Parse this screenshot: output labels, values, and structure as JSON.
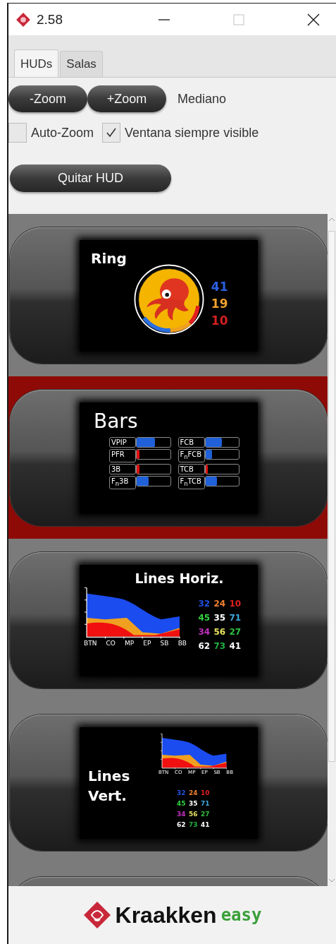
{
  "window": {
    "title": "2.58"
  },
  "tabs": [
    {
      "label": "HUDs",
      "selected": true
    },
    {
      "label": "Salas",
      "selected": false
    }
  ],
  "zoom": {
    "buttons": [
      "-Zoom",
      "+Zoom"
    ],
    "size": "Mediano"
  },
  "options": [
    {
      "label": "Auto-Zoom",
      "checked": false
    },
    {
      "label": "Ventana siempre visible",
      "checked": true
    }
  ],
  "remove_button": "Quitar HUD",
  "huds": [
    {
      "kind": "ring",
      "title": "Ring",
      "selected": false,
      "stats": [
        {
          "value": "41",
          "color": "#2a5fe0"
        },
        {
          "value": "19",
          "color": "#f0a030"
        },
        {
          "value": "10",
          "color": "#d42020"
        }
      ]
    },
    {
      "kind": "bars",
      "title": "Bars",
      "selected": true,
      "bars": [
        {
          "label": "VPIP",
          "level": 0.55,
          "color": "#2060d8"
        },
        {
          "label": "FCB",
          "level": 0.5,
          "color": "#2060d8"
        },
        {
          "label": "PFR",
          "level": 0.08,
          "color": "#e01010"
        },
        {
          "label": "F$_{n}$FCB",
          "level": 0.2,
          "color": "#2060d8"
        },
        {
          "label": "3B",
          "level": 0.08,
          "color": "#e01010"
        },
        {
          "label": "TCB",
          "level": 0.08,
          "color": "#e01010"
        },
        {
          "label": "F$_{n}$3B",
          "level": 0.35,
          "color": "#2060d8"
        },
        {
          "label": "F$_{n}$TCB",
          "level": 0.35,
          "color": "#2060d8"
        }
      ]
    },
    {
      "kind": "lines_horizontal",
      "title": "Lines Horiz.",
      "selected": false,
      "positions": [
        "BTN",
        "CO",
        "MP",
        "EP",
        "SB",
        "BB"
      ],
      "stats": [
        {
          "value": "32",
          "color": "#2050e0"
        },
        {
          "value": "24",
          "color": "#f08030"
        },
        {
          "value": "10",
          "color": "#e02020"
        },
        {
          "value": "45",
          "color": "#30d040"
        },
        {
          "value": "35",
          "color": "#ffffff"
        },
        {
          "value": "71",
          "color": "#40a8e0"
        },
        {
          "value": "34",
          "color": "#c030c0"
        },
        {
          "value": "56",
          "color": "#e8e060"
        },
        {
          "value": "27",
          "color": "#30c040"
        },
        {
          "value": "62",
          "color": "#ffffff"
        },
        {
          "value": "73",
          "color": "#20b040"
        },
        {
          "value": "41",
          "color": "#ffffff"
        }
      ]
    },
    {
      "kind": "lines_vertical",
      "title": "Lines Vert.",
      "selected": false,
      "positions": [
        "BTN",
        "CO",
        "MP",
        "EP",
        "SB",
        "BB"
      ],
      "stats": [
        {
          "value": "32",
          "color": "#2050e0"
        },
        {
          "value": "24",
          "color": "#f08030"
        },
        {
          "value": "10",
          "color": "#e02020"
        },
        {
          "value": "45",
          "color": "#30d040"
        },
        {
          "value": "35",
          "color": "#ffffff"
        },
        {
          "value": "71",
          "color": "#40a8e0"
        },
        {
          "value": "34",
          "color": "#c030c0"
        },
        {
          "value": "56",
          "color": "#e8e060"
        },
        {
          "value": "27",
          "color": "#30c040"
        },
        {
          "value": "62",
          "color": "#ffffff"
        },
        {
          "value": "73",
          "color": "#20b040"
        },
        {
          "value": "41",
          "color": "#ffffff"
        }
      ]
    },
    {
      "kind": "cut",
      "selected": false
    }
  ],
  "footer": {
    "brand": "Kraakken",
    "edition": "easy"
  }
}
